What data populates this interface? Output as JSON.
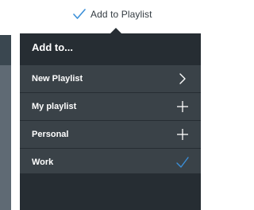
{
  "trigger": {
    "label": "Add to Playlist",
    "icon": "check-icon"
  },
  "popover": {
    "title": "Add to...",
    "items": [
      {
        "label": "New Playlist",
        "icon": "chevron-right-icon"
      },
      {
        "label": "My playlist",
        "icon": "plus-icon"
      },
      {
        "label": "Personal",
        "icon": "plus-icon"
      },
      {
        "label": "Work",
        "icon": "check-icon",
        "selected": true
      }
    ]
  },
  "colors": {
    "popover_bg": "#262d33",
    "row_bg": "#3a4248",
    "accent": "#3b8fd8"
  }
}
